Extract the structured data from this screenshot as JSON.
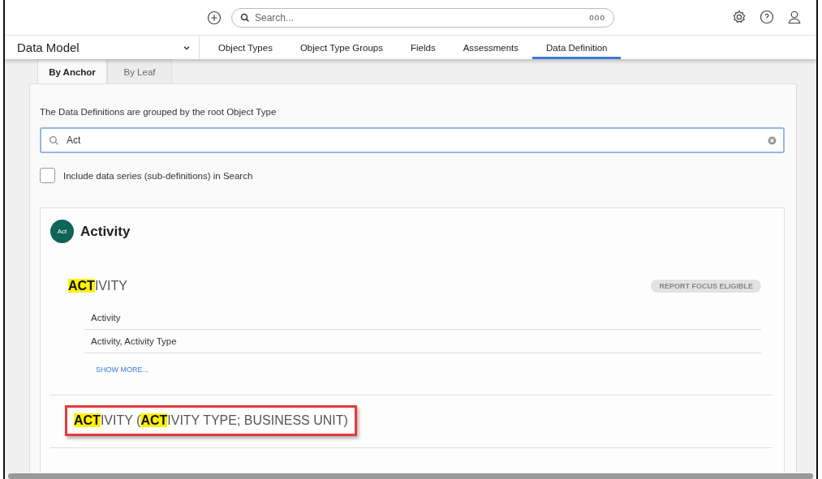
{
  "topbar": {
    "search": {
      "placeholder": "Search..."
    },
    "more_label": "ooo"
  },
  "nav": {
    "module": "Data Model",
    "tabs": [
      {
        "label": "Object Types",
        "selected": false
      },
      {
        "label": "Object Type Groups",
        "selected": false
      },
      {
        "label": "Fields",
        "selected": false
      },
      {
        "label": "Assessments",
        "selected": false
      },
      {
        "label": "Data Definition",
        "selected": true
      }
    ]
  },
  "subtabs": [
    {
      "label": "By Anchor",
      "selected": true
    },
    {
      "label": "By Leaf",
      "selected": false
    }
  ],
  "description": "The Data Definitions are grouped by the root Object Type",
  "filter": {
    "value": "Act"
  },
  "include_series": {
    "label": "Include data series (sub-definitions) in Search",
    "checked": false
  },
  "group": {
    "avatar": "Act",
    "color": "#0f6357",
    "title": "Activity",
    "sections": [
      {
        "title": [
          {
            "text": "ACT",
            "highlight": true
          },
          {
            "text": "IVITY",
            "highlight": false
          }
        ],
        "outlined": false,
        "badge": "REPORT FOCUS ELIGIBLE",
        "rows": [
          "Activity",
          "Activity, Activity Type"
        ],
        "show_more": "SHOW MORE..."
      },
      {
        "title": [
          {
            "text": "ACT",
            "highlight": true
          },
          {
            "text": "IVITY (",
            "highlight": false
          },
          {
            "text": "ACT",
            "highlight": true
          },
          {
            "text": "IVITY TYPE; BUSINESS UNIT)",
            "highlight": false
          }
        ],
        "outlined": true
      }
    ]
  }
}
